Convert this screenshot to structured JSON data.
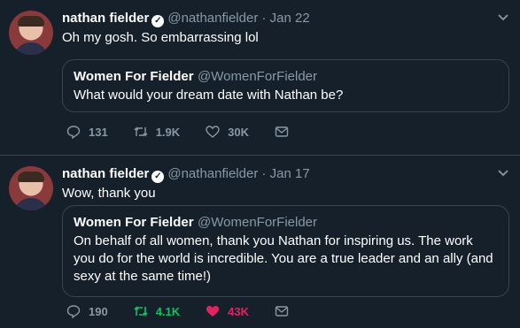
{
  "tweets": [
    {
      "name": "nathan fielder",
      "handle": "@nathanfielder",
      "dot": "·",
      "date": "Jan 22",
      "text": "Oh my gosh. So embarrassing lol",
      "quote": {
        "name": "Women For Fielder",
        "handle": "@WomenForFielder",
        "text": "What would your dream date with Nathan be?"
      },
      "replies": "131",
      "retweets": "1.9K",
      "likes": "30K",
      "retweeted": false,
      "liked": false
    },
    {
      "name": "nathan fielder",
      "handle": "@nathanfielder",
      "dot": "·",
      "date": "Jan 17",
      "text": "Wow, thank you",
      "quote": {
        "name": "Women For Fielder",
        "handle": "@WomenForFielder",
        "text": "On behalf of all women, thank you Nathan for inspiring us. The work you do for the world is incredible. You are a true leader and an ally (and sexy at the same time!)"
      },
      "replies": "190",
      "retweets": "4.1K",
      "likes": "43K",
      "retweeted": true,
      "liked": true
    }
  ],
  "colors": {
    "background": "#15202b",
    "muted": "#8899a6",
    "border": "#38444d",
    "retweet_active": "#17bf63",
    "like_active": "#e0245e"
  },
  "icons": [
    "verified-icon",
    "chevron-down-icon",
    "reply-icon",
    "retweet-icon",
    "like-icon",
    "share-icon"
  ]
}
